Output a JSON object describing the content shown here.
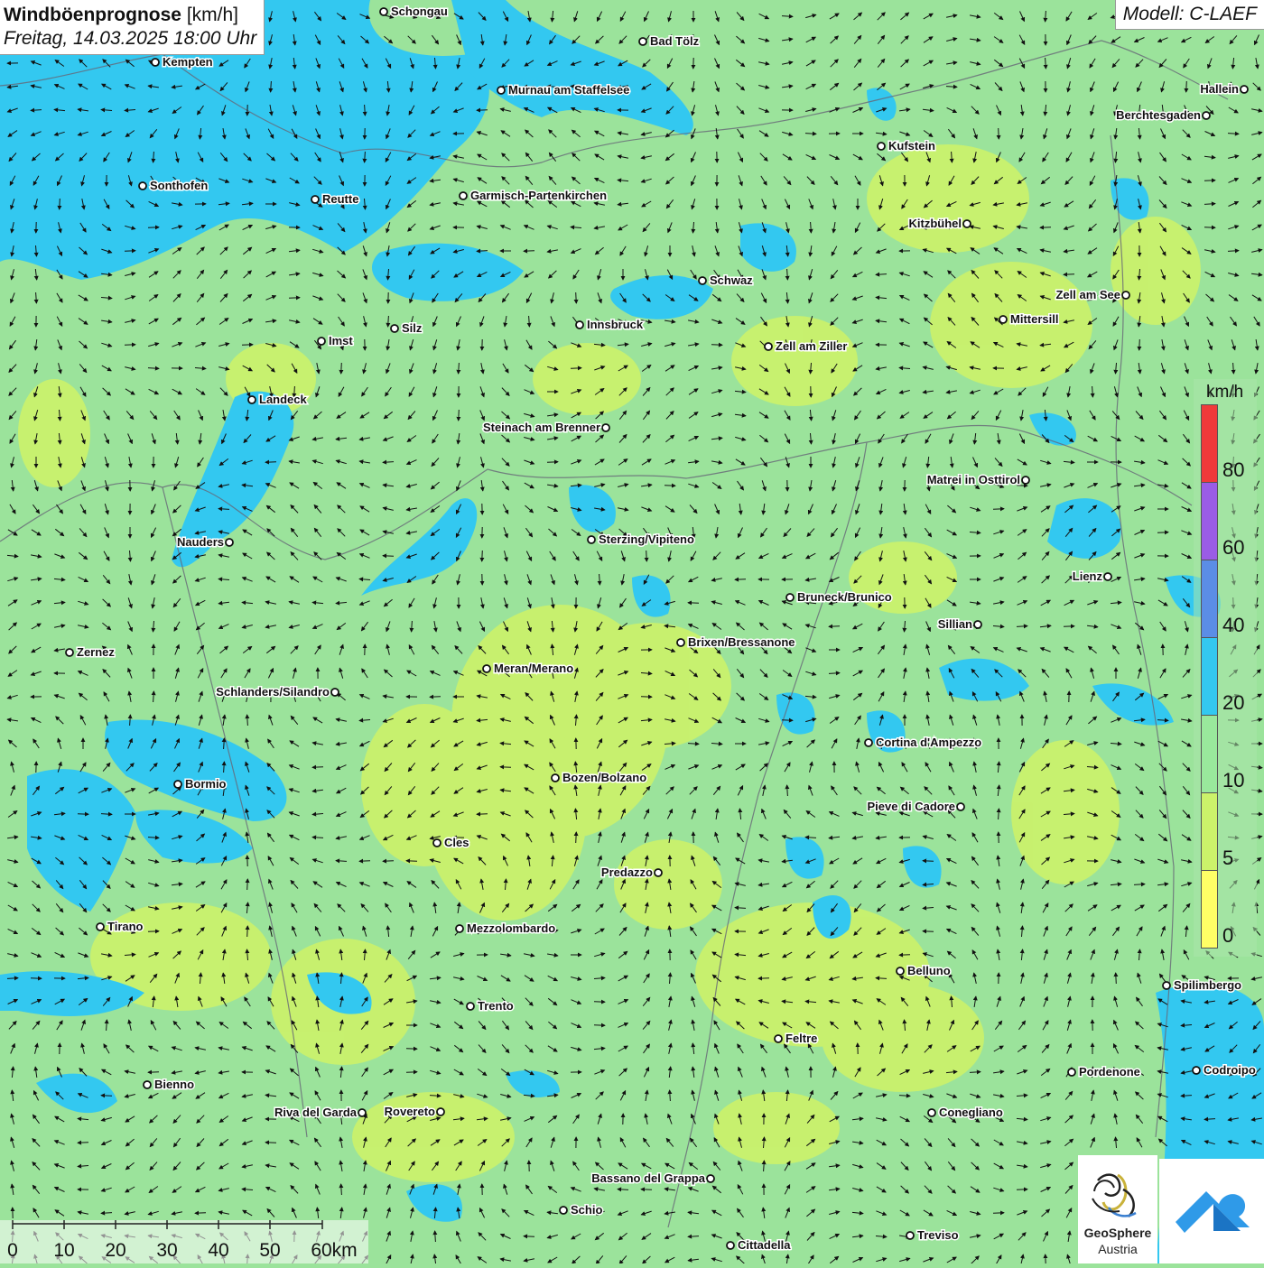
{
  "header": {
    "title_bold": "Windböenprognose",
    "title_unit": "[km/h]",
    "datetime": "Freitag, 14.03.2025 18:00 Uhr",
    "model": "Modell: C-LAEF"
  },
  "legend": {
    "unit": "km/h",
    "classes": [
      {
        "from": 0,
        "to": 5,
        "color": "#ffff66"
      },
      {
        "from": 5,
        "to": 10,
        "color": "#ccf26a"
      },
      {
        "from": 10,
        "to": 20,
        "color": "#99e89c"
      },
      {
        "from": 20,
        "to": 40,
        "color": "#33c8f0"
      },
      {
        "from": 40,
        "to": 60,
        "color": "#5b8de6"
      },
      {
        "from": 60,
        "to": 80,
        "color": "#9a5ce6"
      },
      {
        "from": 80,
        "to": 100,
        "color": "#f03a3a"
      }
    ],
    "ticks": [
      "0",
      "5",
      "10",
      "20",
      "40",
      "60",
      "80"
    ]
  },
  "scale_bar": {
    "labels": [
      "0",
      "10",
      "20",
      "30",
      "40",
      "50",
      "60km"
    ]
  },
  "logos": {
    "geosphere_line1": "GeoSphere",
    "geosphere_line2": "Austria",
    "geosphere_icon": "geosphere-swirl-icon",
    "app_icon": "cloud-arrow-icon"
  },
  "colors": {
    "calm": "#ffff66",
    "light": "#ccf26a",
    "moderate": "#99e89c",
    "fresh": "#33c8f0",
    "strong": "#5b8de6",
    "storm": "#9a5ce6",
    "severe": "#f03a3a",
    "brand_blue": "#2f9ae8"
  },
  "cities": [
    {
      "name": "Schongau"
    },
    {
      "name": "Bad Tölz"
    },
    {
      "name": "Kempten"
    },
    {
      "name": "Murnau am Staffelsee"
    },
    {
      "name": "Hallein"
    },
    {
      "name": "Berchtesgaden"
    },
    {
      "name": "Kufstein"
    },
    {
      "name": "Sonthofen"
    },
    {
      "name": "Reutte"
    },
    {
      "name": "Garmisch-Partenkirchen"
    },
    {
      "name": "Kitzbühel"
    },
    {
      "name": "Schwaz"
    },
    {
      "name": "Zell am See"
    },
    {
      "name": "Mittersill"
    },
    {
      "name": "Silz"
    },
    {
      "name": "Innsbruck"
    },
    {
      "name": "Imst"
    },
    {
      "name": "Zell am Ziller"
    },
    {
      "name": "Landeck"
    },
    {
      "name": "Steinach am Brenner"
    },
    {
      "name": "Matrei in Osttirol"
    },
    {
      "name": "Nauders"
    },
    {
      "name": "Sterzing/Vipiteno"
    },
    {
      "name": "Lienz"
    },
    {
      "name": "Bruneck/Brunico"
    },
    {
      "name": "Sillian"
    },
    {
      "name": "Zernez"
    },
    {
      "name": "Brixen/Bressanone"
    },
    {
      "name": "Meran/Merano"
    },
    {
      "name": "Schlanders/Silandro"
    },
    {
      "name": "Cortina d'Ampezzo"
    },
    {
      "name": "Bozen/Bolzano"
    },
    {
      "name": "Bormio"
    },
    {
      "name": "Pieve di Cadore"
    },
    {
      "name": "Cles"
    },
    {
      "name": "Predazzo"
    },
    {
      "name": "Tirano"
    },
    {
      "name": "Mezzolombardo"
    },
    {
      "name": "Belluno"
    },
    {
      "name": "Spilimbergo"
    },
    {
      "name": "Trento"
    },
    {
      "name": "Feltre"
    },
    {
      "name": "Pordenone"
    },
    {
      "name": "Codroipo"
    },
    {
      "name": "Bienno"
    },
    {
      "name": "Riva del Garda"
    },
    {
      "name": "Rovereto"
    },
    {
      "name": "Conegliano"
    },
    {
      "name": "Bassano del Grappa"
    },
    {
      "name": "Schio"
    },
    {
      "name": "Treviso"
    },
    {
      "name": "Cittadella"
    }
  ]
}
